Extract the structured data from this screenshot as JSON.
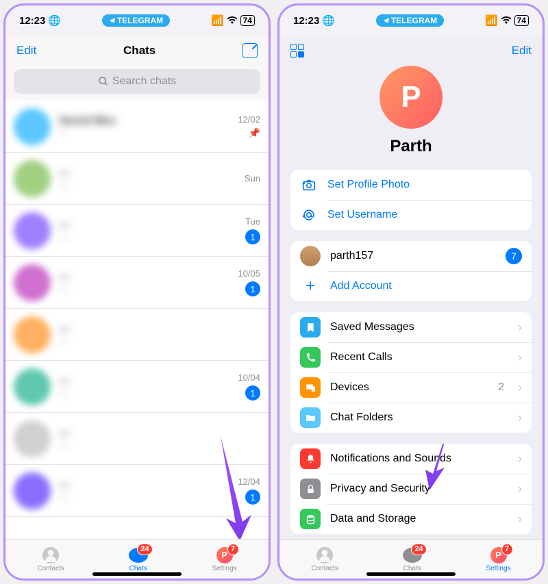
{
  "status": {
    "time": "12:23",
    "pill": "TELEGRAM",
    "battery": "74"
  },
  "left": {
    "nav": {
      "edit": "Edit",
      "title": "Chats"
    },
    "search": {
      "placeholder": "Search chats"
    },
    "chats": [
      {
        "time": "12/02",
        "pinned": true
      },
      {
        "time": "Sun"
      },
      {
        "time": "Tue",
        "badge": "1"
      },
      {
        "time": "10/05",
        "badge": "1"
      },
      {
        "time": "",
        "badge": ""
      },
      {
        "time": "10/04",
        "badge": "1"
      },
      {
        "time": "",
        "badge": ""
      },
      {
        "time": "12/04",
        "badge": "1"
      }
    ],
    "tabs": {
      "contacts": "Contacts",
      "chats": "Chats",
      "chats_badge": "24",
      "settings": "Settings",
      "settings_badge": "7"
    }
  },
  "right": {
    "nav": {
      "edit": "Edit"
    },
    "profile": {
      "initial": "P",
      "name": "Parth"
    },
    "actions": {
      "photo": "Set Profile Photo",
      "username": "Set Username"
    },
    "accounts": {
      "name": "parth157",
      "badge": "7",
      "add": "Add Account"
    },
    "group1": {
      "saved": "Saved Messages",
      "calls": "Recent Calls",
      "devices": "Devices",
      "devices_count": "2",
      "folders": "Chat Folders"
    },
    "group2": {
      "notif": "Notifications and Sounds",
      "privacy": "Privacy and Security",
      "data": "Data and Storage"
    },
    "tabs": {
      "contacts": "Contacts",
      "chats": "Chats",
      "chats_badge": "24",
      "settings": "Settings",
      "settings_badge": "7"
    }
  }
}
